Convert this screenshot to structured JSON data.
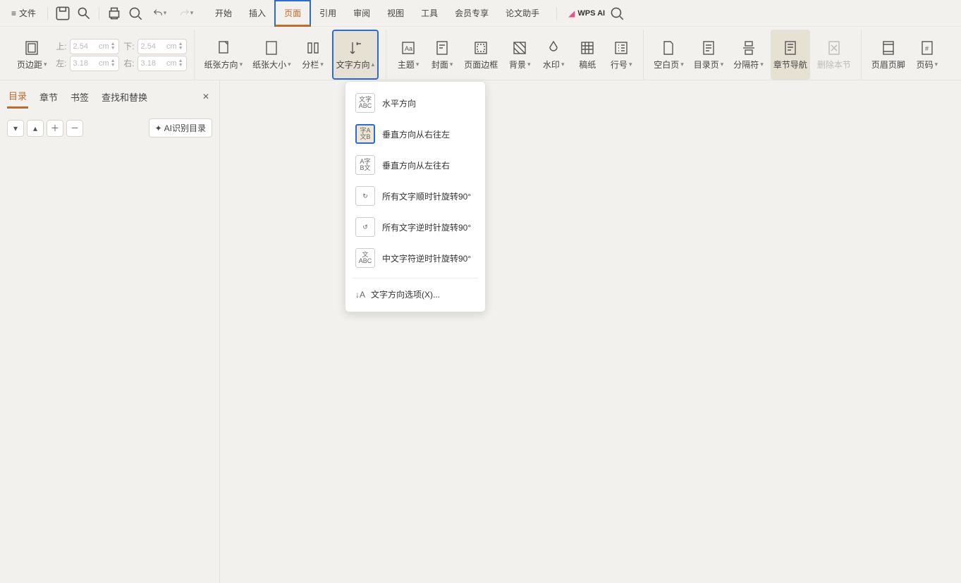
{
  "topbar": {
    "file_menu": "文件",
    "wps_ai": "WPS AI"
  },
  "tabs": [
    "开始",
    "插入",
    "页面",
    "引用",
    "审阅",
    "视图",
    "工具",
    "会员专享",
    "论文助手"
  ],
  "active_tab_index": 2,
  "ribbon": {
    "page_margin": "页边距",
    "margins": {
      "top_label": "上:",
      "bottom_label": "下:",
      "left_label": "左:",
      "right_label": "右:",
      "top": "2.54",
      "bottom": "2.54",
      "left": "3.18",
      "right": "3.18",
      "unit": "cm"
    },
    "paper_dir": "纸张方向",
    "paper_size": "纸张大小",
    "columns": "分栏",
    "text_dir": "文字方向",
    "theme": "主题",
    "cover": "封面",
    "page_border": "页面边框",
    "background": "背景",
    "watermark": "水印",
    "manuscript": "稿纸",
    "line_no": "行号",
    "blank_page": "空白页",
    "toc_page": "目录页",
    "separator": "分隔符",
    "chapter_nav": "章节导航",
    "delete_section": "删除本节",
    "header_footer": "页眉页脚",
    "page_no": "页码"
  },
  "sidebar": {
    "tabs": [
      "目录",
      "章节",
      "书签",
      "查找和替换"
    ],
    "active_tab_index": 0,
    "ai_toc": "AI识别目录"
  },
  "text_dir_menu": {
    "items": [
      "水平方向",
      "垂直方向从右往左",
      "垂直方向从左往右",
      "所有文字顺时针旋转90°",
      "所有文字逆时针旋转90°",
      "中文字符逆时针旋转90°"
    ],
    "selected_index": 1,
    "options_label": "文字方向选项(X)..."
  }
}
